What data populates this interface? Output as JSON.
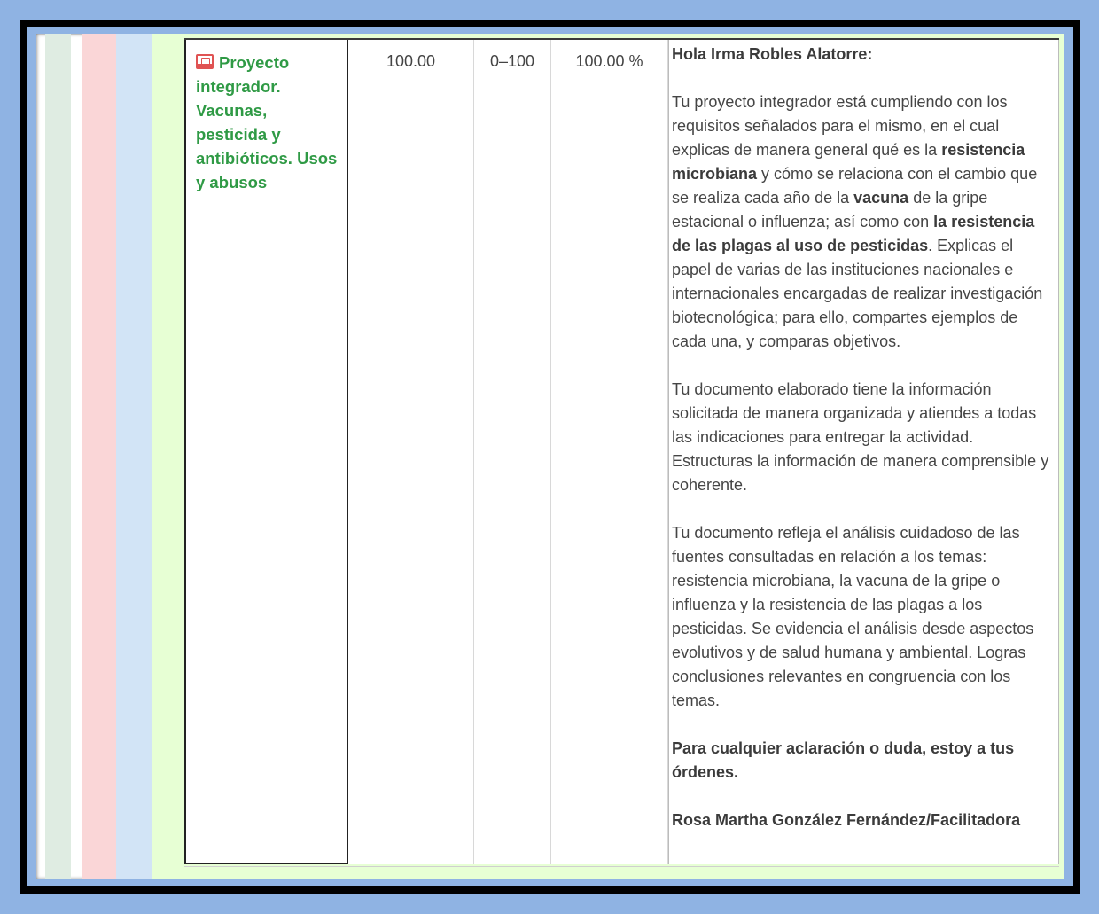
{
  "item": {
    "title": "Proyecto integrador. Vacunas, pesticida y antibióticos. Usos y abusos",
    "icon": "assignment-icon"
  },
  "grade": "100.00",
  "range": "0–100",
  "percentage": "100.00 %",
  "feedback": {
    "greeting": "Hola Irma Robles Alatorre:",
    "p1": [
      "Tu proyecto integrador está cumpliendo con los requisitos señalados para el mismo, en el cual explicas de manera general qué es la ",
      "resistencia microbiana",
      " y cómo se relaciona con el cambio que se realiza cada año de la ",
      "vacuna",
      " de la gripe estacional o influenza; así como con ",
      "la resistencia de las plagas al uso de pesticidas",
      ". Explicas el papel de varias de las instituciones nacionales e internacionales encargadas de realizar investigación biotecnológica; para ello, compartes ejemplos de cada una, y comparas objetivos."
    ],
    "p2": "Tu documento elaborado tiene la información solicitada de manera organizada y atiendes a todas las indicaciones para entregar la actividad. Estructuras la información de manera comprensible y coherente.",
    "p3": "Tu documento refleja el análisis cuidadoso de las fuentes consultadas en relación a los temas: resistencia microbiana, la vacuna de la gripe o influenza y la resistencia de las plagas a los pesticidas. Se evidencia el análisis desde aspectos evolutivos y de salud humana y ambiental. Logras conclusiones relevantes en congruencia con los temas.",
    "closing": "Para cualquier aclaración o duda, estoy a tus órdenes.",
    "signature": "Rosa Martha González Fernández/Facilitadora"
  },
  "colors": {
    "frame_blue": "#8fb3e3",
    "item_green": "#2f9a45",
    "stripe_green": "#dfece2",
    "stripe_pink": "#fad6d7",
    "stripe_blue": "#d2e4f6",
    "stripe_lime": "#e7ffd4"
  }
}
